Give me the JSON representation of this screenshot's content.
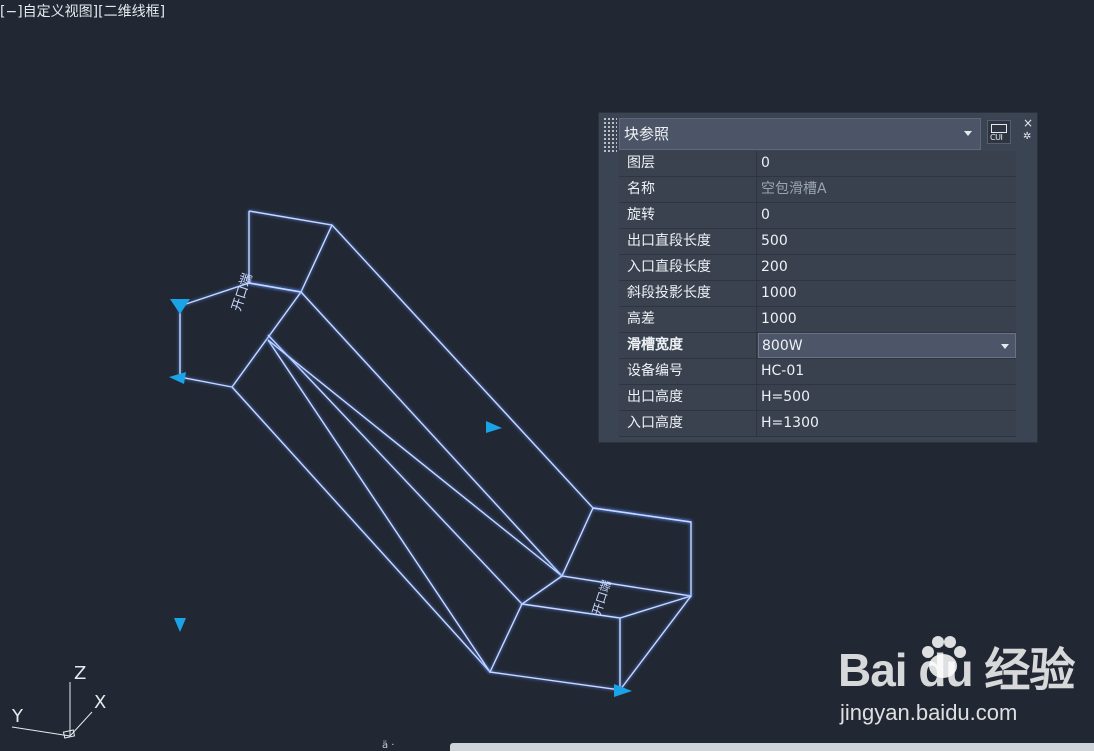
{
  "viewport": {
    "view_label": "[−]自定义视图][二维线框]",
    "axis": {
      "x": "X",
      "y": "Y",
      "z": "Z"
    },
    "model_text": [
      "开口端",
      "开口端"
    ]
  },
  "properties": {
    "type_label": "块参照",
    "cui_label": "CUI",
    "close_icon": "×",
    "gear_icon": "✲",
    "rows": [
      {
        "name": "图层",
        "value": "0"
      },
      {
        "name": "名称",
        "value": "空包滑槽A"
      },
      {
        "name": "旋转",
        "value": "0"
      },
      {
        "name": "出口直段长度",
        "value": "500"
      },
      {
        "name": "入口直段长度",
        "value": "200"
      },
      {
        "name": "斜段投影长度",
        "value": "1000"
      },
      {
        "name": "高差",
        "value": "1000"
      },
      {
        "name": "滑槽宽度",
        "value": "800W"
      },
      {
        "name": "设备编号",
        "value": "HC-01"
      },
      {
        "name": "出口高度",
        "value": "H=500"
      },
      {
        "name": "入口高度",
        "value": "H=1300"
      }
    ]
  },
  "watermark": {
    "logo": "Bai  du 经验",
    "url": "jingyan.baidu.com"
  },
  "status_mark": "ä ·"
}
